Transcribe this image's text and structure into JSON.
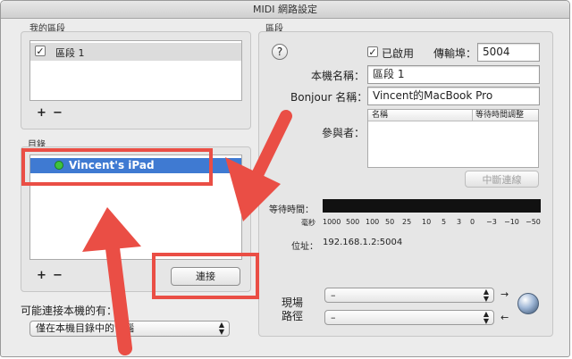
{
  "window": {
    "title": "MIDI 網路設定"
  },
  "my_sessions": {
    "title": "我的區段",
    "items": [
      {
        "label": "區段 1",
        "checked": true
      }
    ],
    "add_label": "+",
    "remove_label": "−"
  },
  "directory": {
    "title": "目錄",
    "items": [
      {
        "label": "Vincent's iPad",
        "status_color": "#3fc23f"
      }
    ],
    "add_label": "+",
    "remove_label": "−",
    "connect_label": "連接"
  },
  "who_may_connect": {
    "label": "可能連接本機的有：",
    "value": "僅在本機目錄中的電腦"
  },
  "session": {
    "title": "區段",
    "help_label": "?",
    "enabled_label": "已啟用",
    "enabled": true,
    "port_label": "傳輸埠：",
    "port_value": "5004",
    "local_name_label": "本機名稱：",
    "local_name_value": "區段 1",
    "bonjour_label": "Bonjour 名稱：",
    "bonjour_value": "Vincent的MacBook Pro",
    "participants_label": "參與者：",
    "participants_columns": [
      "名稱",
      "等待時間調整"
    ],
    "disconnect_label": "中斷連線",
    "latency_label": "等待時間：",
    "latency_unit": "毫秒",
    "latency_ticks": [
      "1000",
      "500",
      "100",
      "50",
      "25",
      "10",
      "5",
      "3",
      "0",
      "−3",
      "−10",
      "−50"
    ],
    "address_label": "位址：",
    "address_value": "192.168.1.2:5004",
    "live_routing_label_1": "現場",
    "live_routing_label_2": "路徑",
    "route_in_value": "–",
    "route_out_value": "–"
  },
  "colors": {
    "selection": "#3f7ad2",
    "annotation": "#ea4e45",
    "latency_bar": "#111111"
  }
}
